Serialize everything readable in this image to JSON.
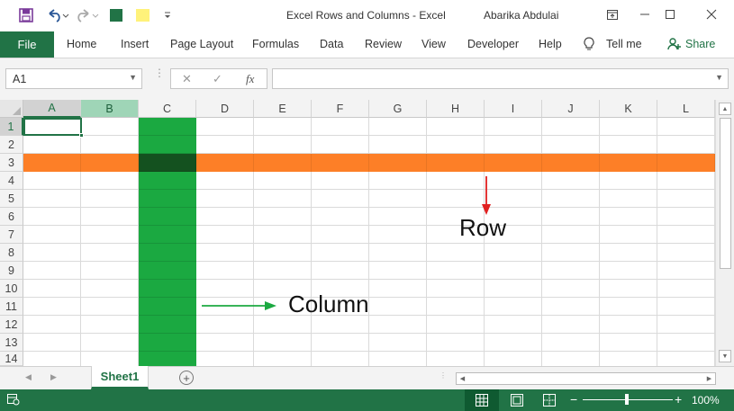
{
  "window": {
    "title": "Excel Rows and Columns  -  Excel",
    "user": "Abarika Abdulai",
    "qat_icons": [
      "save-icon",
      "undo-icon",
      "redo-icon",
      "green-square-icon",
      "yellow-square-icon",
      "customize-icon"
    ],
    "controls": [
      "ribbon-display-icon",
      "minimize-icon",
      "maximize-icon",
      "close-icon"
    ]
  },
  "ribbon": {
    "file": "File",
    "tabs": [
      "Home",
      "Insert",
      "Page Layout",
      "Formulas",
      "Data",
      "Review",
      "View",
      "Developer",
      "Help"
    ],
    "tell_me": "Tell me",
    "share": "Share"
  },
  "formula_bar": {
    "name_box": "A1",
    "fx": "fx",
    "value": ""
  },
  "grid": {
    "columns": [
      "A",
      "B",
      "C",
      "D",
      "E",
      "F",
      "G",
      "H",
      "I",
      "J",
      "K",
      "L"
    ],
    "rows": [
      "1",
      "2",
      "3",
      "4",
      "5",
      "6",
      "7",
      "8",
      "9",
      "10",
      "11",
      "12",
      "13",
      "14"
    ],
    "active_cell": "A1",
    "highlighted_row": "3",
    "highlighted_column": "C",
    "selected_header_column": "A",
    "tinted_header_column": "B"
  },
  "annotations": {
    "row_label": "Row",
    "column_label": "Column",
    "row_arrow_color": "#e02020",
    "column_arrow_color": "#1ba941"
  },
  "colors": {
    "excel_green": "#217346",
    "row_fill": "#fd7f27",
    "column_fill": "#1ba941",
    "intersection_fill": "#14511f"
  },
  "sheets": {
    "tabs": [
      "Sheet1"
    ],
    "active": "Sheet1"
  },
  "status": {
    "zoom": "100%",
    "zoom_minus": "−",
    "zoom_plus": "+"
  }
}
